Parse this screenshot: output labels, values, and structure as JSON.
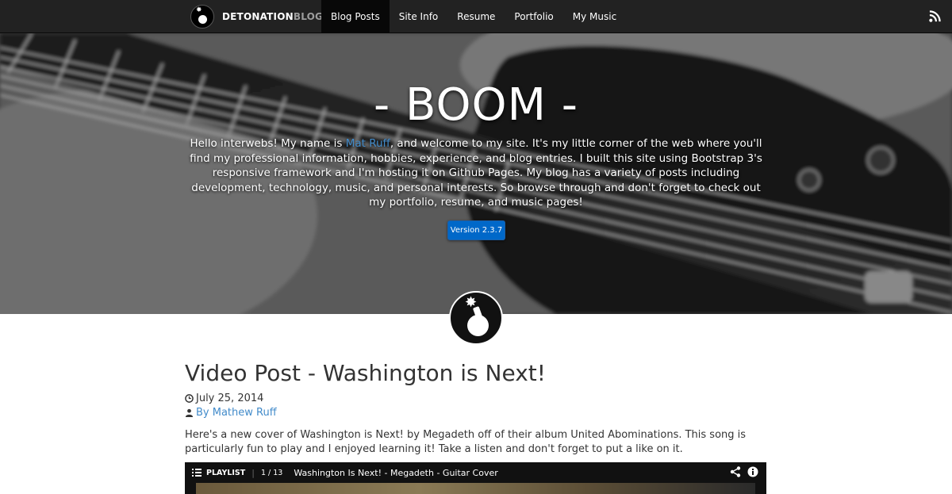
{
  "navbar": {
    "brand_primary": "DETONATION",
    "brand_secondary": "BLOG",
    "items": [
      {
        "label": "Blog Posts",
        "active": true
      },
      {
        "label": "Site Info",
        "active": false
      },
      {
        "label": "Resume",
        "active": false
      },
      {
        "label": "Portfolio",
        "active": false
      },
      {
        "label": "My Music",
        "active": false
      }
    ],
    "rss_icon": "rss-icon"
  },
  "hero": {
    "title": "- BOOM -",
    "intro_before": "Hello interwebs! My name is ",
    "intro_link": "Mat Ruff",
    "intro_after": ", and welcome to my site. It's my little corner of the web where you'll find my professional information, hobbies, experience, and blog entries. I built this site using Bootstrap 3's responsive framework and I'm hosting it on Github Pages. My blog has a variety of posts including development, technology, music, and personal interests. So browse through and don't forget to check out my portfolio, resume, and music pages!",
    "version_button": "Version 2.3.7"
  },
  "post": {
    "title": "Video Post - Washington is Next!",
    "date": "July 25, 2014",
    "author": "By Mathew Ruff",
    "body": "Here's a new cover of Washington is Next! by Megadeth off of their album United Abominations. This song is particularly fun to play and I enjoyed learning it! Take a listen and don't forget to put a like on it."
  },
  "video": {
    "playlist_label": "PLAYLIST",
    "count": "1 / 13",
    "title": "Washington Is Next! - Megadeth - Guitar Cover"
  },
  "colors": {
    "navbar_bg": "#222222",
    "link": "#428bca",
    "version_button": "#0068c9"
  }
}
